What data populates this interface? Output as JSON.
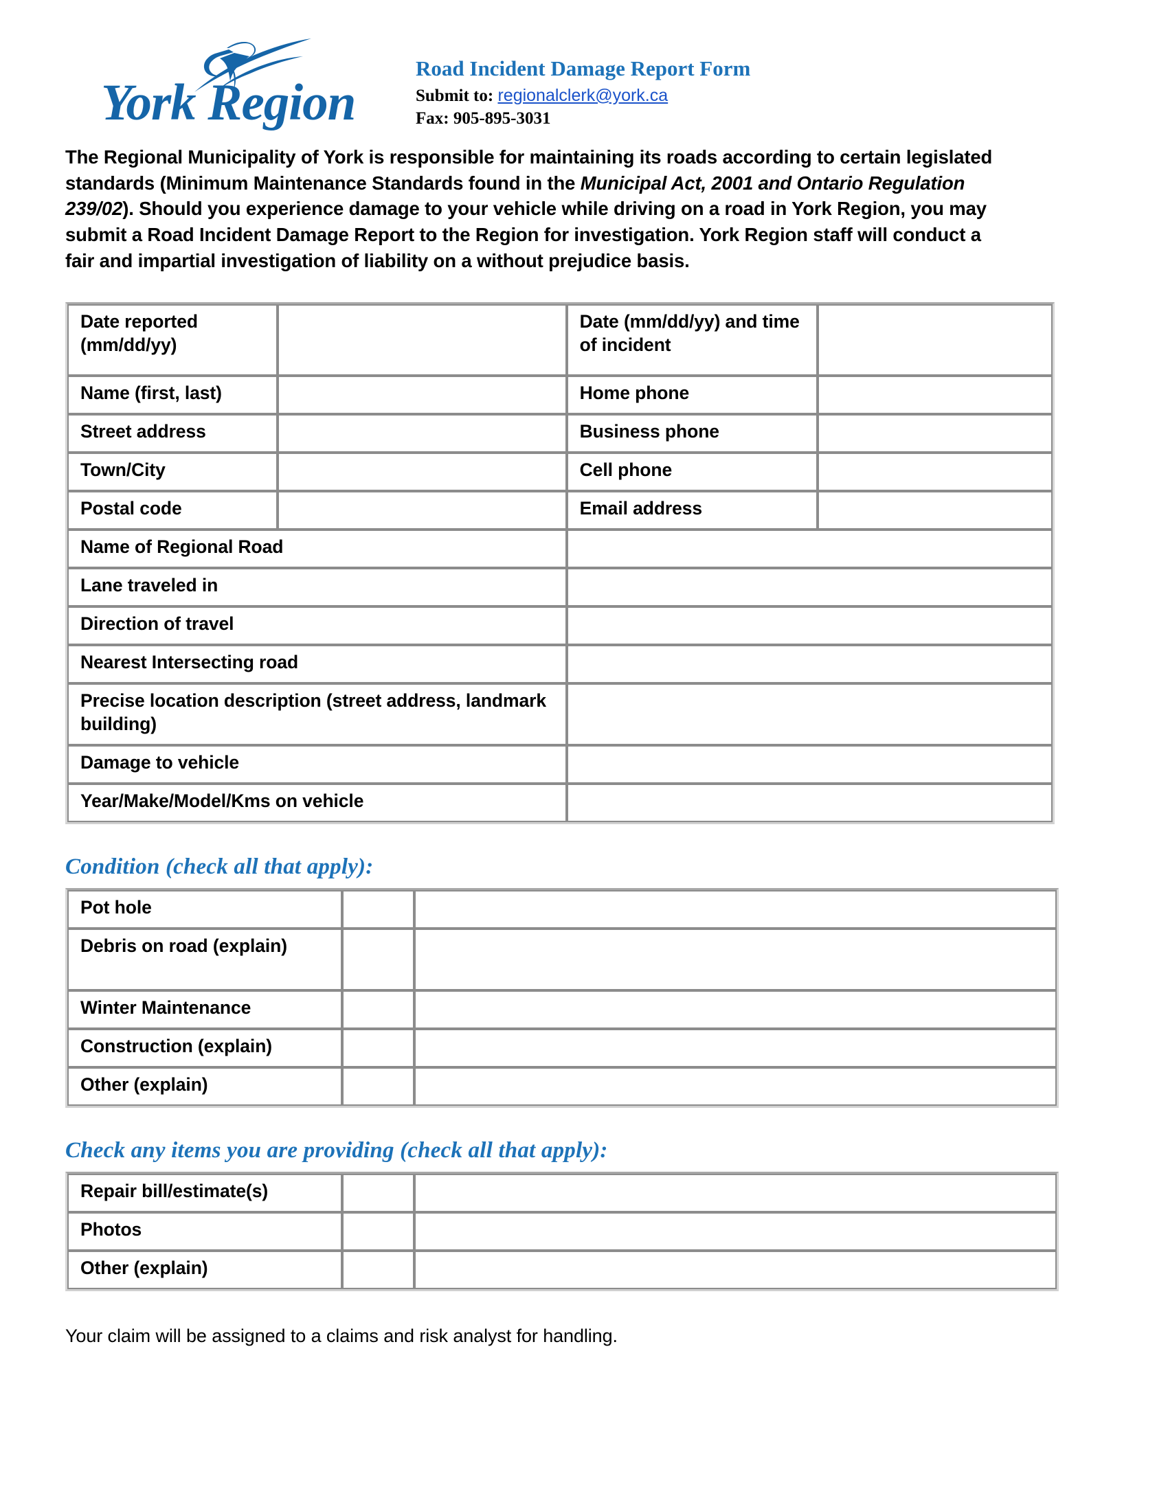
{
  "header": {
    "logo_word": "York Region",
    "logo_mark_name": "york-region-swoosh-star-logo",
    "title": "Road Incident Damage Report Form",
    "submit_prefix": "Submit to:",
    "submit_email": "regionalclerk@york.ca",
    "fax": "Fax: 905-895-3031",
    "brand_blue": "#1565a8",
    "heading_blue": "#1d72b8",
    "link_blue": "#1a52c9"
  },
  "intro": {
    "part1": "The Regional Municipality of York is responsible for maintaining its roads according to certain legislated standards (Minimum Maintenance Standards found in the ",
    "italic": "Municipal Act, 2001 and Ontario Regulation 239/02",
    "part2": "). Should you experience damage to your vehicle while driving on a road in York Region, you may submit a Road Incident Damage Report to the Region for investigation. York Region staff will conduct a fair and impartial investigation of liability on a without prejudice basis."
  },
  "main_table": {
    "paired_rows": [
      {
        "left_label": "Date reported (mm/dd/yy)",
        "right_label": "Date (mm/dd/yy) and time of incident",
        "left_value": "",
        "right_value": ""
      },
      {
        "left_label": "Name (first, last)",
        "right_label": "Home phone",
        "left_value": "",
        "right_value": ""
      },
      {
        "left_label": "Street address",
        "right_label": "Business phone",
        "left_value": "",
        "right_value": ""
      },
      {
        "left_label": "Town/City",
        "right_label": "Cell phone",
        "left_value": "",
        "right_value": ""
      },
      {
        "left_label": "Postal code",
        "right_label": "Email address",
        "left_value": "",
        "right_value": ""
      }
    ],
    "wide_rows": [
      {
        "label": "Name of Regional Road",
        "value": "",
        "blue": true
      },
      {
        "label": "Lane traveled in",
        "value": "",
        "blue": false
      },
      {
        "label": "Direction of travel",
        "value": "",
        "blue": false
      },
      {
        "label": "Nearest Intersecting road",
        "value": "",
        "blue": false
      },
      {
        "label": "Precise location description (street address, landmark building)",
        "value": "",
        "blue": false
      },
      {
        "label": "Damage to vehicle",
        "value": "",
        "blue": false
      },
      {
        "label": "Year/Make/Model/Kms on vehicle",
        "value": "",
        "blue": false
      }
    ]
  },
  "condition_section": {
    "heading": "Condition (check all that apply):",
    "rows": [
      {
        "label": "Pot hole",
        "check": "",
        "detail": ""
      },
      {
        "label": "Debris on road (explain)",
        "check": "",
        "detail": ""
      },
      {
        "label": "Winter Maintenance",
        "check": "",
        "detail": ""
      },
      {
        "label": "Construction (explain)",
        "check": "",
        "detail": ""
      },
      {
        "label": "Other (explain)",
        "check": "",
        "detail": ""
      }
    ]
  },
  "providing_section": {
    "heading": "Check any items you are providing (check all that apply):",
    "rows": [
      {
        "label": "Repair bill/estimate(s)",
        "check": "",
        "detail": ""
      },
      {
        "label": "Photos",
        "check": "",
        "detail": ""
      },
      {
        "label": "Other (explain)",
        "check": "",
        "detail": ""
      }
    ]
  },
  "closing": "Your claim will be assigned to a claims and risk analyst for handling."
}
